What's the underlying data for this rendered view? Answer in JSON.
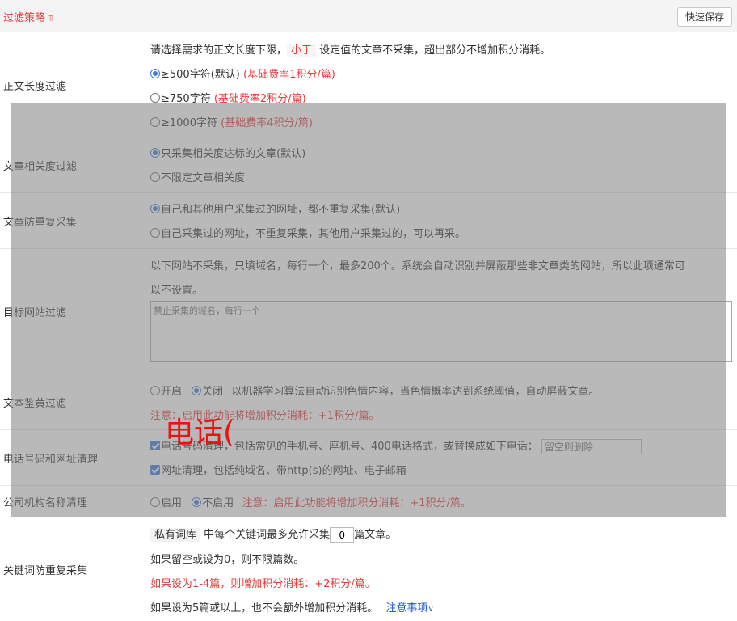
{
  "header": {
    "title": "过滤策略",
    "chevron_icon": "double-chevron-down-icon",
    "save_label": "快速保存"
  },
  "length_filter": {
    "label": "正文长度过滤",
    "desc_prefix": "请选择需求的正文长度下限，",
    "desc_tag": "小于",
    "desc_suffix": "设定值的文章不采集，超出部分不增加积分消耗。",
    "options": [
      {
        "text": "≥500字符(默认)",
        "note": "(基础费率1积分/篇)",
        "selected": true
      },
      {
        "text": "≥750字符",
        "note": "(基础费率2积分/篇)",
        "selected": false
      },
      {
        "text": "≥1000字符",
        "note": "(基础费率4积分/篇)",
        "selected": false
      }
    ]
  },
  "relevance_filter": {
    "label": "文章相关度过滤",
    "options": [
      {
        "text": "只采集相关度达标的文章(默认)",
        "selected": true
      },
      {
        "text": "不限定文章相关度",
        "selected": false
      }
    ]
  },
  "dedupe_filter": {
    "label": "文章防重复采集",
    "options": [
      {
        "text": "自己和其他用户采集过的网址，都不重复采集(默认)",
        "selected": true
      },
      {
        "text": "自己采集过的网址，不重复采集，其他用户采集过的，可以再采。",
        "selected": false
      }
    ]
  },
  "site_filter": {
    "label": "目标网站过滤",
    "desc_line1": "以下网站不采集，只填域名，每行一个，最多200个。系统会自动识别并屏蔽那些非文章类的网站，所以此项通常可",
    "desc_line2": "以不设置。",
    "textarea_placeholder": "禁止采集的域名，每行一个"
  },
  "porn_filter": {
    "label": "文本鉴黄过滤",
    "option_on": "开启",
    "option_off": "关闭",
    "selected": "关闭",
    "desc": "以机器学习算法自动识别色情内容，当色情概率达到系统阈值，自动屏蔽文章。",
    "notice": "注意：启用此功能将增加积分消耗：+1积分/篇。"
  },
  "phone_filter": {
    "label": "电话号码和网址清理",
    "phone_text": "电话号码清理，包括常见的手机号、座机号、400电话格式，或替换成如下电话：",
    "phone_placeholder": "留空则删除",
    "phone_checked": true,
    "url_text": "网址清理，包括纯域名、带http(s)的网址、电子邮箱",
    "url_checked": true
  },
  "company_filter": {
    "label": "公司机构名称清理",
    "option_on": "启用",
    "option_off": "不启用",
    "selected": "不启用",
    "notice": "注意：启用此功能将增加积分消耗：+1积分/篇。"
  },
  "keyword_filter": {
    "label": "关键词防重复采集",
    "tag": "私有词库",
    "line1_mid": "中每个关键词最多允许采集",
    "value": "0",
    "line1_suffix": "篇文章。",
    "line2": "如果留空或设为0，则不限篇数。",
    "line3": "如果设为1-4篇，则增加积分消耗：+2积分/篇。",
    "line4": "如果设为5篇或以上，也不会额外增加积分消耗。",
    "notice_link": "注意事项"
  },
  "overlay": {
    "text": "电话("
  },
  "colors": {
    "accent_red": "#e4393c",
    "link_blue": "#2255cc",
    "radio_blue": "#3b7ad9",
    "overlay_gray": "#808080"
  }
}
